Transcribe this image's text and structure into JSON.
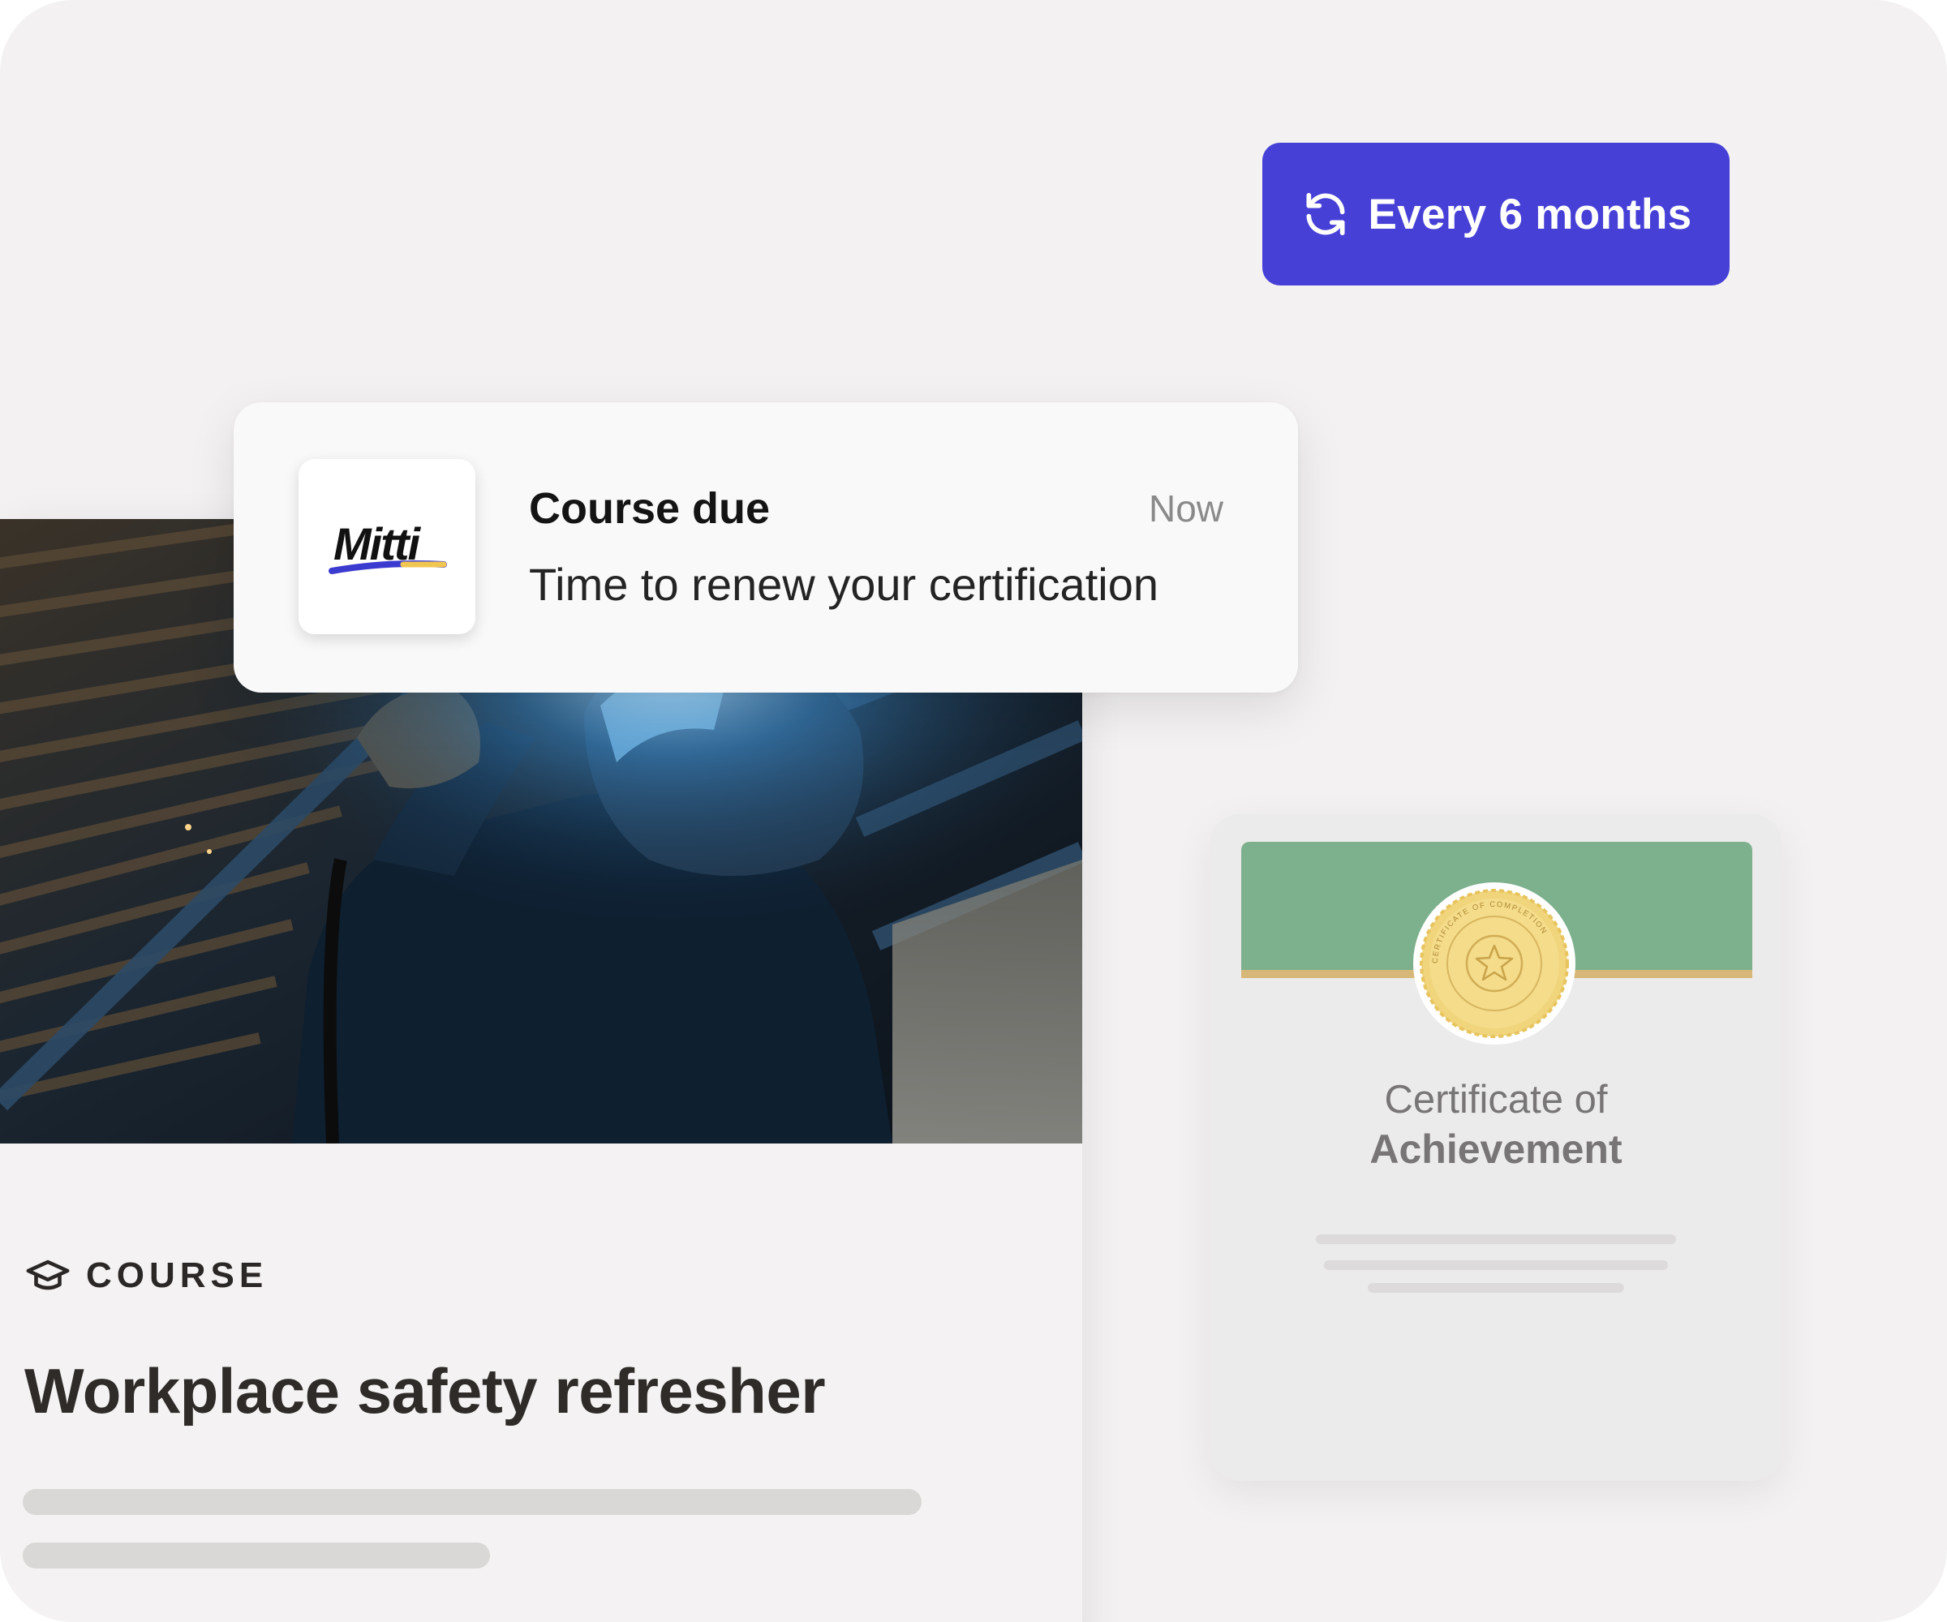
{
  "recurrence": {
    "icon": "refresh-icon",
    "label": "Every 6 months",
    "color": "#4740d6"
  },
  "notification": {
    "brand": "Mitti",
    "title": "Course due",
    "time": "Now",
    "body": "Time to renew your certification"
  },
  "course": {
    "kind_icon": "graduation-cap-icon",
    "kind": "COURSE",
    "title": "Workplace safety refresher"
  },
  "certificate": {
    "line1": "Certificate of",
    "line2": "Achievement",
    "seal_text": "CERTIFICATE OF COMPLETION",
    "banner_color": "#7db08d",
    "seal_color": "#f1d57c"
  }
}
